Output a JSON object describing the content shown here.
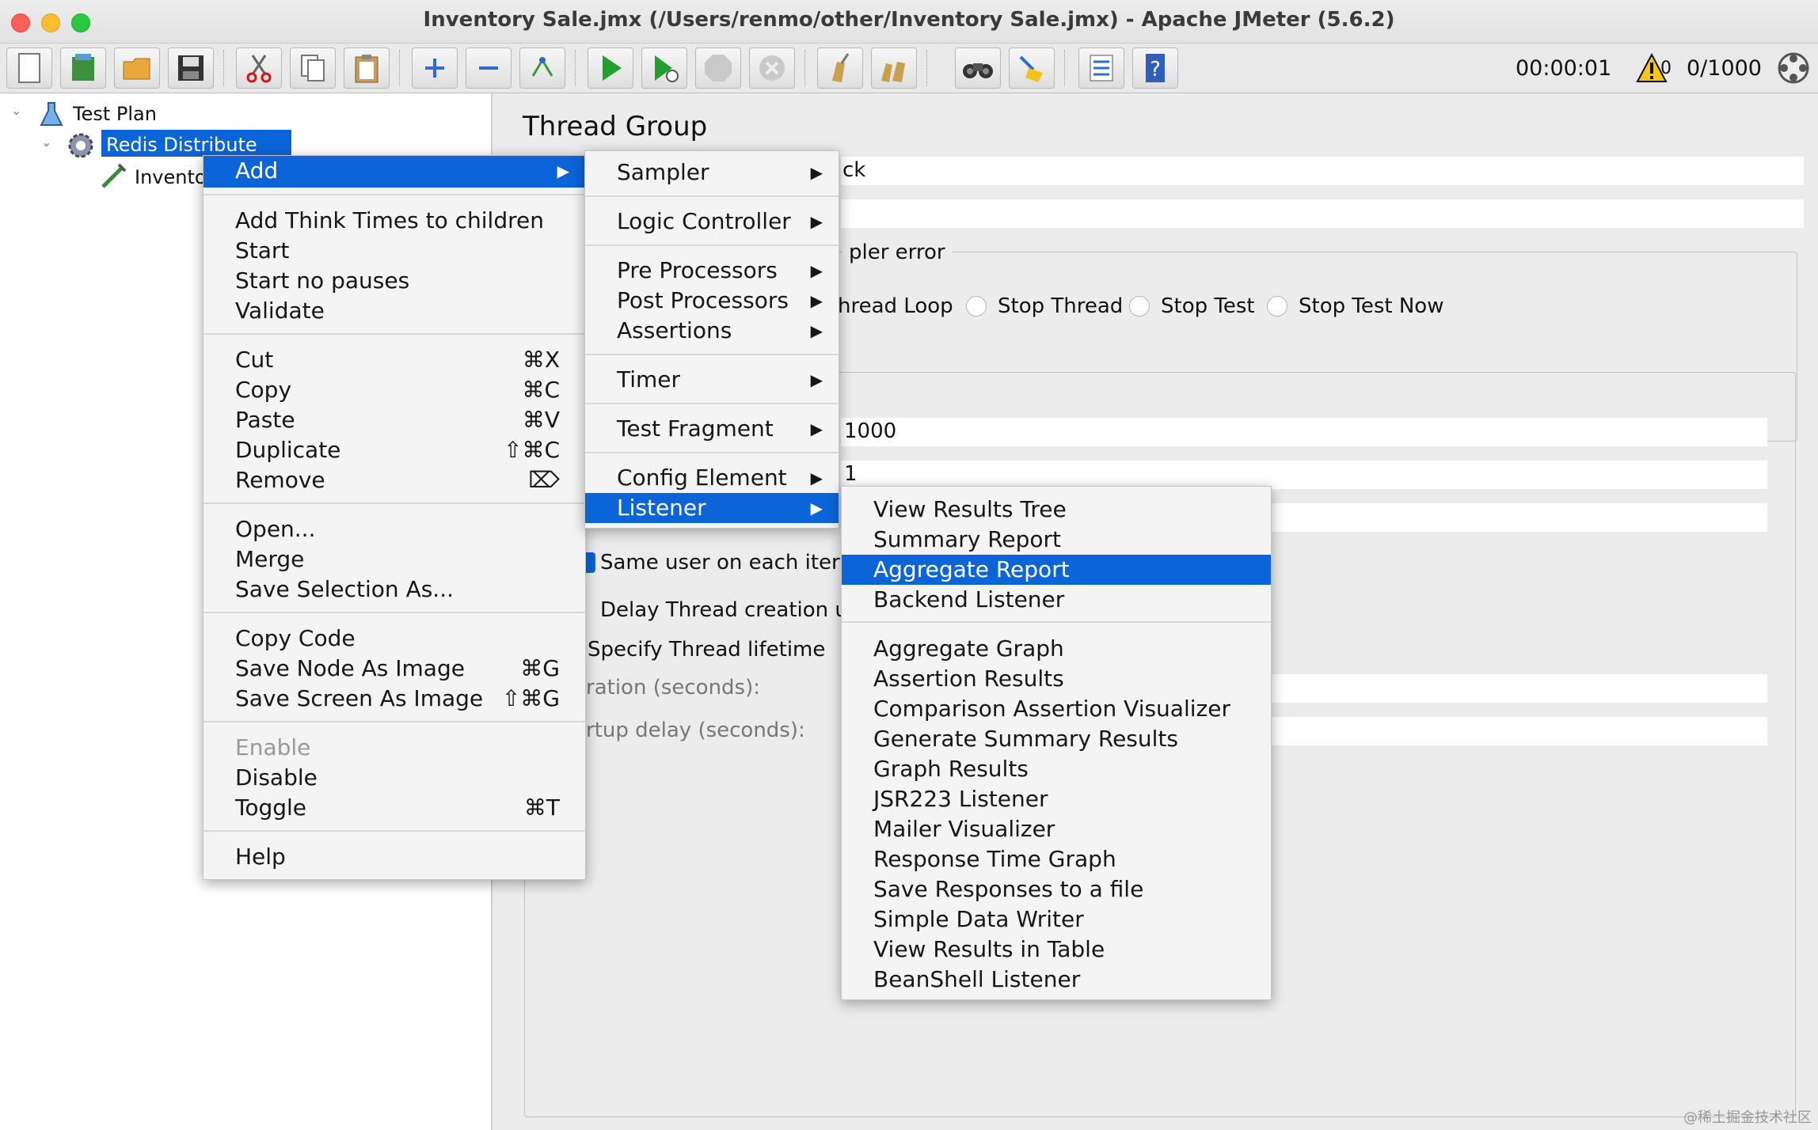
{
  "window": {
    "title": "Inventory Sale.jmx (/Users/renmo/other/Inventory Sale.jmx) - Apache JMeter (5.6.2)"
  },
  "toolbar": {
    "timer": "00:00:01",
    "warning_count": "0",
    "thread_status": "0/1000",
    "icons": [
      "new-icon",
      "templates-icon",
      "open-icon",
      "save-icon",
      "cut-icon",
      "copy-icon",
      "paste-icon",
      "expand-icon",
      "collapse-icon",
      "toggle-icon",
      "start-icon",
      "start-no-pauses-icon",
      "stop-icon",
      "shutdown-icon",
      "clear-icon",
      "clear-all-icon",
      "search-icon",
      "reset-search-icon",
      "function-helper-icon",
      "help-icon"
    ]
  },
  "tree": {
    "root": "Test Plan",
    "thread_group": "Redis Distribute Lock",
    "child": "Invento"
  },
  "panel": {
    "title": "Thread Group",
    "name_value_tail": "ck",
    "error_section_tail": "pler error",
    "radios": [
      "hread Loop",
      "Stop Thread",
      "Stop Test",
      "Stop Test Now"
    ],
    "threads_value": "1000",
    "rampup_value": "1",
    "same_user": "Same user on each iterat",
    "delay_thread": "Delay Thread creation u",
    "specify_lifetime": "Specify Thread lifetime",
    "duration_label": "ration (seconds):",
    "startup_label": "rtup delay (seconds):"
  },
  "context_menu": {
    "add": "Add",
    "items": {
      "think_times": "Add Think Times to children",
      "start": "Start",
      "start_no_pauses": "Start no pauses",
      "validate": "Validate",
      "cut": "Cut",
      "cut_sc": "⌘X",
      "copy": "Copy",
      "copy_sc": "⌘C",
      "paste": "Paste",
      "paste_sc": "⌘V",
      "duplicate": "Duplicate",
      "duplicate_sc": "⇧⌘C",
      "remove": "Remove",
      "remove_sc": "⌦",
      "open": "Open...",
      "merge": "Merge",
      "save_selection": "Save Selection As...",
      "copy_code": "Copy Code",
      "save_node_image": "Save Node As Image",
      "save_node_image_sc": "⌘G",
      "save_screen_image": "Save Screen As Image",
      "save_screen_image_sc": "⇧⌘G",
      "enable": "Enable",
      "disable": "Disable",
      "toggle": "Toggle",
      "toggle_sc": "⌘T",
      "help": "Help"
    }
  },
  "add_menu": {
    "sampler": "Sampler",
    "logic_controller": "Logic Controller",
    "pre_processors": "Pre Processors",
    "post_processors": "Post Processors",
    "assertions": "Assertions",
    "timer": "Timer",
    "test_fragment": "Test Fragment",
    "config_element": "Config Element",
    "listener": "Listener"
  },
  "listener_menu": {
    "view_results_tree": "View Results Tree",
    "summary_report": "Summary Report",
    "aggregate_report": "Aggregate Report",
    "backend_listener": "Backend Listener",
    "aggregate_graph": "Aggregate Graph",
    "assertion_results": "Assertion Results",
    "comparison_assertion": "Comparison Assertion Visualizer",
    "generate_summary": "Generate Summary Results",
    "graph_results": "Graph Results",
    "jsr223_listener": "JSR223 Listener",
    "mailer_visualizer": "Mailer Visualizer",
    "response_time_graph": "Response Time Graph",
    "save_responses": "Save Responses to a file",
    "simple_data_writer": "Simple Data Writer",
    "view_results_table": "View Results in Table",
    "beanshell_listener": "BeanShell Listener"
  },
  "watermark": "@稀土掘金技术社区",
  "colors": {
    "selection": "#0b64d8",
    "menu_bg": "#f4f4f4"
  }
}
